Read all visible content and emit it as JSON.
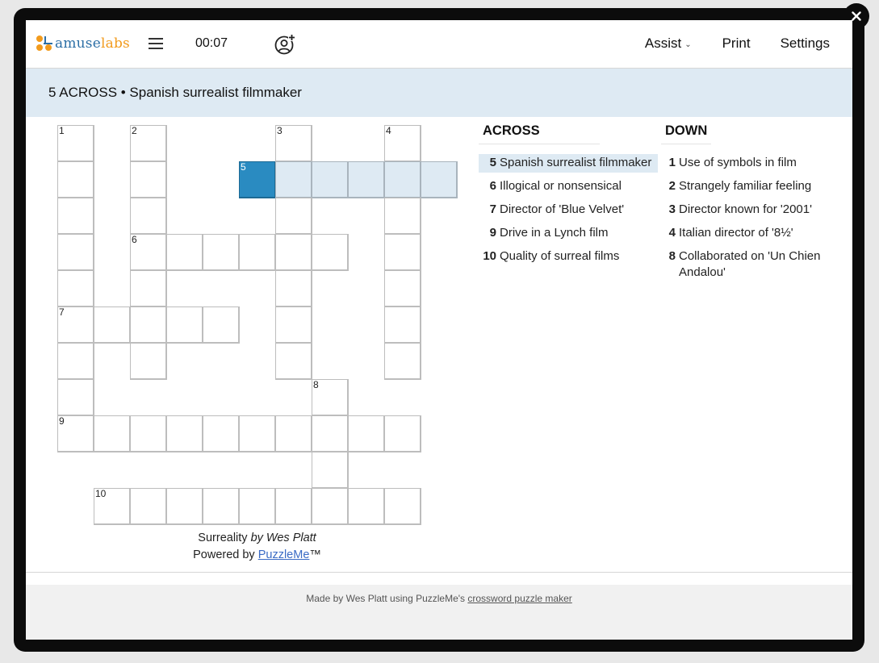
{
  "app": {
    "brand_part1": "amuse",
    "brand_part2": "labs",
    "timer": "00:07",
    "toolbar": {
      "assist_label": "Assist",
      "print_label": "Print",
      "settings_label": "Settings"
    },
    "colors": {
      "accent_blue": "#2a8bc1",
      "highlight": "#deeaf3",
      "brand_orange": "#f29b1d",
      "brand_blue": "#2c6fa6"
    }
  },
  "current_clue": {
    "number": "5",
    "direction": "ACROSS",
    "text": "Spanish surrealist filmmaker",
    "display": "5 ACROSS • Spanish surrealist filmmaker"
  },
  "grid": {
    "rows": 11,
    "cols": 11,
    "cells": [
      {
        "r": 0,
        "c": 0,
        "n": "1"
      },
      {
        "r": 0,
        "c": 2,
        "n": "2"
      },
      {
        "r": 0,
        "c": 6,
        "n": "3"
      },
      {
        "r": 0,
        "c": 9,
        "n": "4"
      },
      {
        "r": 1,
        "c": 0
      },
      {
        "r": 1,
        "c": 2
      },
      {
        "r": 1,
        "c": 5,
        "n": "5",
        "state": "active"
      },
      {
        "r": 1,
        "c": 6,
        "state": "hl"
      },
      {
        "r": 1,
        "c": 7,
        "state": "hl"
      },
      {
        "r": 1,
        "c": 8,
        "state": "hl"
      },
      {
        "r": 1,
        "c": 9,
        "state": "hl"
      },
      {
        "r": 1,
        "c": 10,
        "state": "hl"
      },
      {
        "r": 2,
        "c": 0
      },
      {
        "r": 2,
        "c": 2
      },
      {
        "r": 2,
        "c": 6
      },
      {
        "r": 2,
        "c": 9
      },
      {
        "r": 3,
        "c": 0
      },
      {
        "r": 3,
        "c": 2,
        "n": "6"
      },
      {
        "r": 3,
        "c": 3
      },
      {
        "r": 3,
        "c": 4
      },
      {
        "r": 3,
        "c": 5
      },
      {
        "r": 3,
        "c": 6
      },
      {
        "r": 3,
        "c": 7
      },
      {
        "r": 3,
        "c": 9
      },
      {
        "r": 4,
        "c": 0
      },
      {
        "r": 4,
        "c": 2
      },
      {
        "r": 4,
        "c": 6
      },
      {
        "r": 4,
        "c": 9
      },
      {
        "r": 5,
        "c": 0,
        "n": "7"
      },
      {
        "r": 5,
        "c": 1
      },
      {
        "r": 5,
        "c": 2
      },
      {
        "r": 5,
        "c": 3
      },
      {
        "r": 5,
        "c": 4
      },
      {
        "r": 5,
        "c": 6
      },
      {
        "r": 5,
        "c": 9
      },
      {
        "r": 6,
        "c": 0
      },
      {
        "r": 6,
        "c": 2
      },
      {
        "r": 6,
        "c": 6
      },
      {
        "r": 6,
        "c": 9
      },
      {
        "r": 7,
        "c": 0
      },
      {
        "r": 7,
        "c": 7,
        "n": "8"
      },
      {
        "r": 8,
        "c": 0,
        "n": "9"
      },
      {
        "r": 8,
        "c": 1
      },
      {
        "r": 8,
        "c": 2
      },
      {
        "r": 8,
        "c": 3
      },
      {
        "r": 8,
        "c": 4
      },
      {
        "r": 8,
        "c": 5
      },
      {
        "r": 8,
        "c": 6
      },
      {
        "r": 8,
        "c": 7
      },
      {
        "r": 8,
        "c": 8
      },
      {
        "r": 8,
        "c": 9
      },
      {
        "r": 9,
        "c": 7
      },
      {
        "r": 10,
        "c": 1,
        "n": "10"
      },
      {
        "r": 10,
        "c": 2
      },
      {
        "r": 10,
        "c": 3
      },
      {
        "r": 10,
        "c": 4
      },
      {
        "r": 10,
        "c": 5
      },
      {
        "r": 10,
        "c": 6
      },
      {
        "r": 10,
        "c": 7
      },
      {
        "r": 10,
        "c": 8
      },
      {
        "r": 10,
        "c": 9
      }
    ]
  },
  "credits": {
    "title": "Surreality",
    "by": "by Wes Platt",
    "powered_prefix": "Powered by ",
    "powered_link": "PuzzleMe",
    "powered_suffix": "™"
  },
  "clues": {
    "across_heading": "ACROSS",
    "down_heading": "DOWN",
    "across": [
      {
        "num": "5",
        "text": "Spanish surrealist filmmaker",
        "selected": true
      },
      {
        "num": "6",
        "text": "Illogical or nonsensical"
      },
      {
        "num": "7",
        "text": "Director of 'Blue Velvet'"
      },
      {
        "num": "9",
        "text": "Drive in a Lynch film"
      },
      {
        "num": "10",
        "text": "Quality of surreal films"
      }
    ],
    "down": [
      {
        "num": "1",
        "text": "Use of symbols in film"
      },
      {
        "num": "2",
        "text": "Strangely familiar feeling"
      },
      {
        "num": "3",
        "text": "Director known for '2001'"
      },
      {
        "num": "4",
        "text": "Italian director of '8½'"
      },
      {
        "num": "8",
        "text": "Collaborated on 'Un Chien Andalou'"
      }
    ]
  },
  "footer": {
    "prefix": "Made by Wes Platt using PuzzleMe's ",
    "link": "crossword puzzle maker"
  }
}
